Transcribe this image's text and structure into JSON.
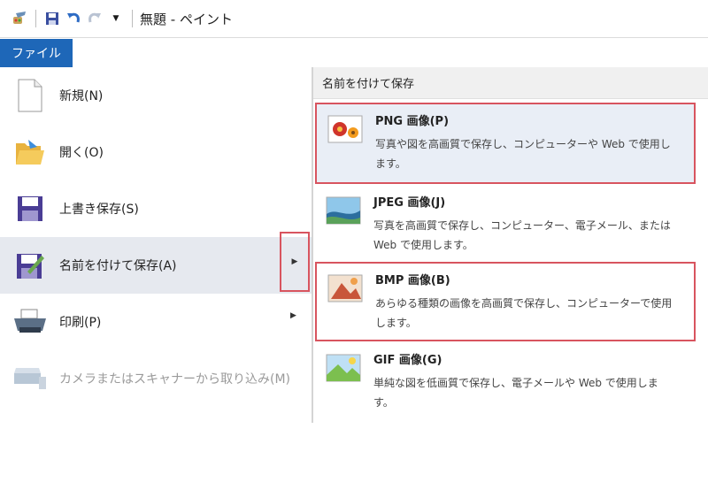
{
  "window": {
    "title": "無題 - ペイント"
  },
  "ribbon": {
    "file_tab": "ファイル"
  },
  "file_menu": {
    "items": [
      {
        "label": "新規(N)",
        "icon": "new-document-icon"
      },
      {
        "label": "開く(O)",
        "icon": "open-folder-icon"
      },
      {
        "label": "上書き保存(S)",
        "icon": "save-icon"
      },
      {
        "label": "名前を付けて保存(A)",
        "icon": "save-as-icon"
      },
      {
        "label": "印刷(P)",
        "icon": "printer-icon"
      },
      {
        "label": "カメラまたはスキャナーから取り込み(M)",
        "icon": "scanner-icon"
      }
    ]
  },
  "save_as_menu": {
    "header": "名前を付けて保存",
    "options": [
      {
        "name": "PNG 画像(P)",
        "description": "写真や図を高画質で保存し、コンピューターや Web で使用します。"
      },
      {
        "name": "JPEG 画像(J)",
        "description": "写真を高画質で保存し、コンピューター、電子メール、または Web で使用します。"
      },
      {
        "name": "BMP 画像(B)",
        "description": "あらゆる種類の画像を高画質で保存し、コンピューターで使用します。"
      },
      {
        "name": "GIF 画像(G)",
        "description": "単純な図を低画質で保存し、電子メールや Web で使用します。"
      }
    ]
  },
  "colors": {
    "file_tab": "#1e67b8",
    "highlight_border": "#d8545f",
    "hover": "#e6e9ef"
  }
}
